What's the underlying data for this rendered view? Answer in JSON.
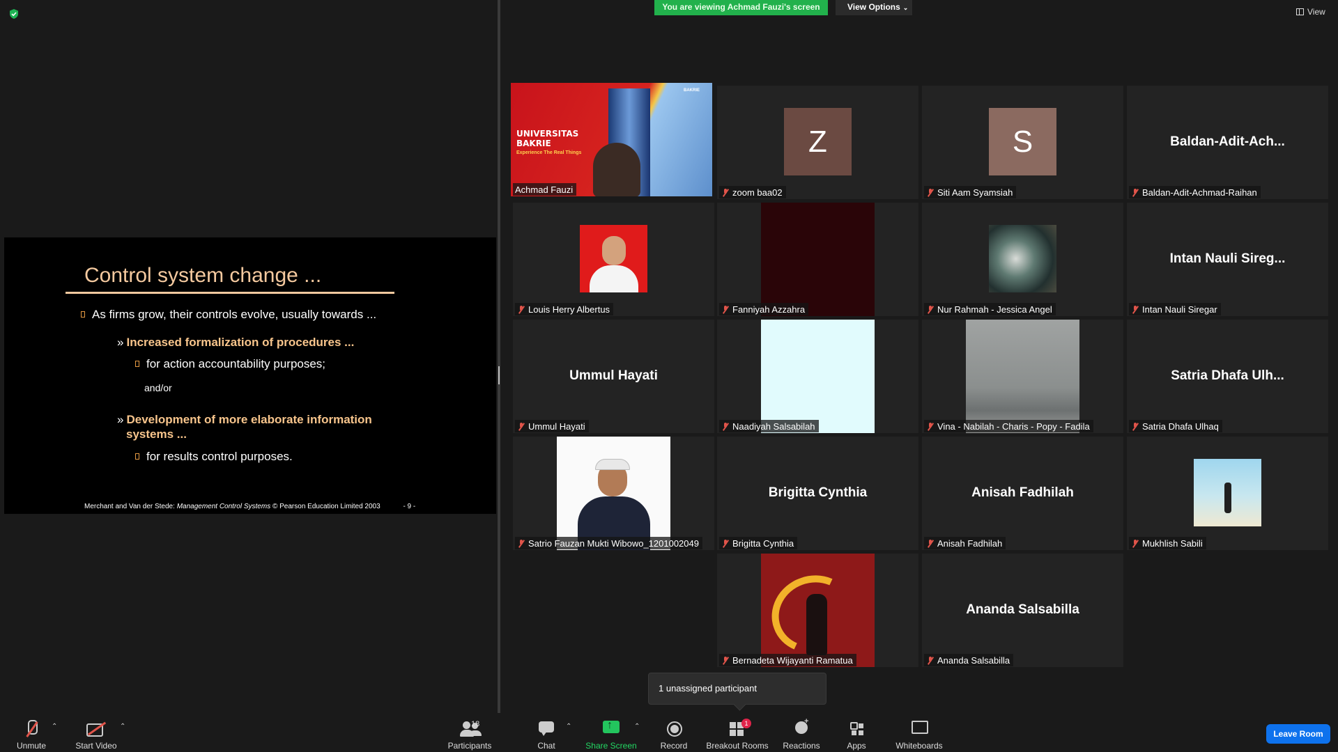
{
  "banner": {
    "viewing": "You are viewing Achmad Fauzi's screen",
    "view_options": "View Options",
    "view": "View"
  },
  "slide": {
    "title": "Control system change ...",
    "line1": "As firms grow, their controls evolve, usually towards ...",
    "line2": "Increased formalization of procedures ...",
    "line3": "for action accountability purposes;",
    "line4": "and/or",
    "line5a": "Development of more elaborate information",
    "line5b": "systems ...",
    "line6": "for results control purposes.",
    "footer_pre": "Merchant and Van der Stede: ",
    "footer_italic": "Management Control Systems",
    "footer_post": " © Pearson Education Limited 2003",
    "footer_page": "- 9 -"
  },
  "bakrie": {
    "title_line1": "UNIVERSITAS",
    "title_line2": "BAKRIE",
    "tagline": "Experience The Real Things",
    "logo": "BAKRIE"
  },
  "participants": [
    {
      "name": "Achmad Fauzi"
    },
    {
      "name": "zoom baa02",
      "letter": "Z"
    },
    {
      "name": "Siti Aam Syamsiah",
      "letter": "S"
    },
    {
      "name": "Baldan-Adit-Achmad-Raihan",
      "display": "Baldan-Adit-Ach..."
    },
    {
      "name": "Louis Herry Albertus"
    },
    {
      "name": "Fanniyah Azzahra"
    },
    {
      "name": "Nur Rahmah - Jessica Angel"
    },
    {
      "name": "Intan Nauli Siregar",
      "display": "Intan Nauli Sireg..."
    },
    {
      "name": "Ummul Hayati",
      "display": "Ummul Hayati"
    },
    {
      "name": "Naadiyah Salsabilah"
    },
    {
      "name": "Vina - Nabilah - Charis - Popy - Fadila"
    },
    {
      "name": "Satria Dhafa Ulhaq",
      "display": "Satria Dhafa Ulh..."
    },
    {
      "name": "Satrio Fauzan Mukti Wibowo_1201002049"
    },
    {
      "name": "Brigitta Cynthia",
      "display": "Brigitta Cynthia"
    },
    {
      "name": "Anisah Fadhilah",
      "display": "Anisah Fadhilah"
    },
    {
      "name": "Mukhlish Sabili"
    },
    {
      "name": "Bernadeta Wijayanti Ramatua"
    },
    {
      "name": "Ananda Salsabilla",
      "display": "Ananda Salsabilla"
    }
  ],
  "tooltip": "1 unassigned participant",
  "toolbar": {
    "unmute": "Unmute",
    "start_video": "Start Video",
    "participants": "Participants",
    "participants_count": "18",
    "chat": "Chat",
    "share_screen": "Share Screen",
    "record": "Record",
    "breakout_rooms": "Breakout Rooms",
    "breakout_badge": "1",
    "reactions": "Reactions",
    "apps": "Apps",
    "whiteboards": "Whiteboards",
    "leave": "Leave Room"
  },
  "colors": {
    "banner_green": "#22b14c",
    "active_speaker_border": "#e9e94a",
    "leave_blue": "#0e72ed",
    "muted_red": "#e0544a"
  }
}
